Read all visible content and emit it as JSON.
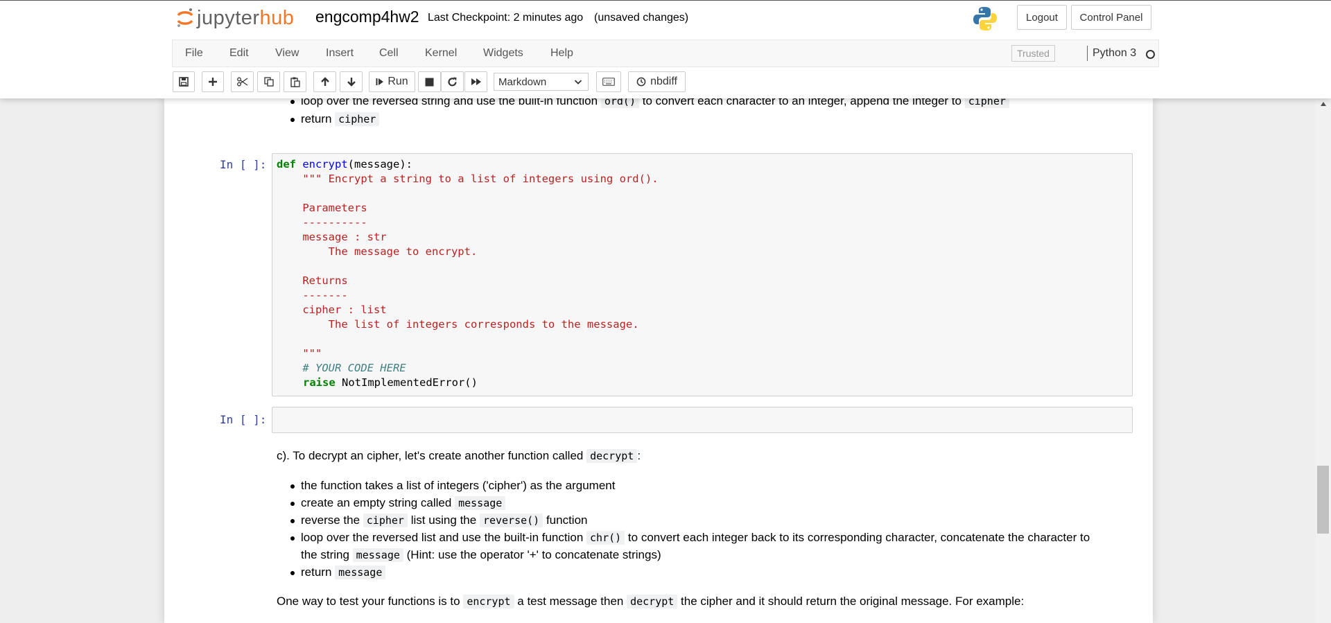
{
  "header": {
    "logo": {
      "part1": "jupyter",
      "part2": "hub"
    },
    "notebook_name": "engcomp4hw2",
    "checkpoint": "Last Checkpoint: 2 minutes ago",
    "unsaved": "(unsaved changes)",
    "logout": "Logout",
    "control_panel": "Control Panel"
  },
  "menubar": {
    "items": [
      "File",
      "Edit",
      "View",
      "Insert",
      "Cell",
      "Kernel",
      "Widgets",
      "Help"
    ],
    "trusted": "Trusted",
    "kernel": "Python 3"
  },
  "toolbar": {
    "run": "Run",
    "cell_type": "Markdown",
    "nbdiff": "nbdiff"
  },
  "notebook": {
    "top_bullets": {
      "b1": {
        "t1": "loop over the reversed string and use the built-in function",
        "c1": "ord()",
        "t2": "to convert each character to an integer, append the integer to",
        "c2": "cipher"
      },
      "b2": {
        "t1": "return",
        "c1": "cipher"
      }
    },
    "cell1": {
      "prompt": "In [ ]:",
      "lines": {
        "l1a": "def",
        "l1b": "encrypt",
        "l1c": "(message):",
        "l2": "    \"\"\" Encrypt a string to a list of integers using ord().",
        "l4": "    Parameters",
        "l5": "    ----------",
        "l6": "    message : str",
        "l7": "        The message to encrypt.",
        "l9": "    Returns",
        "l10": "    -------",
        "l11": "    cipher : list",
        "l12": "        The list of integers corresponds to the message.",
        "l14": "    \"\"\"",
        "l15": "    # YOUR CODE HERE",
        "l16a": "raise",
        "l16b": " NotImplementedError()"
      }
    },
    "cell2": {
      "prompt": "In [ ]:"
    },
    "section_c": {
      "intro_t1": "c). To decrypt an cipher, let's create another function called",
      "intro_c1": "decrypt",
      "intro_t2": ":",
      "b1": "the function takes a list of integers ('cipher') as the argument",
      "b2": {
        "t1": "create an empty string called",
        "c1": "message"
      },
      "b3": {
        "t1": "reverse the",
        "c1": "cipher",
        "t2": "list using the",
        "c2": "reverse()",
        "t3": "function"
      },
      "b4": {
        "t1": "loop over the reversed list and use the built-in function",
        "c1": "chr()",
        "t2": "to convert each integer back to its corresponding character, concatenate the character to",
        "t3": "the string",
        "c2": "message",
        "t4": "(Hint: use the operator '+' to concatenate strings)"
      },
      "b5": {
        "t1": "return",
        "c1": "message"
      },
      "closing": {
        "t1": "One way to test your functions is to",
        "c1": "encrypt",
        "t2": "a test message then",
        "c2": "decrypt",
        "t3": "the cipher and it should return the original message. For example:"
      }
    }
  },
  "colors": {
    "brand_orange": "#f37726",
    "prompt_blue": "#303f9f",
    "keyword_green": "#008000",
    "string_red": "#ba2121"
  }
}
